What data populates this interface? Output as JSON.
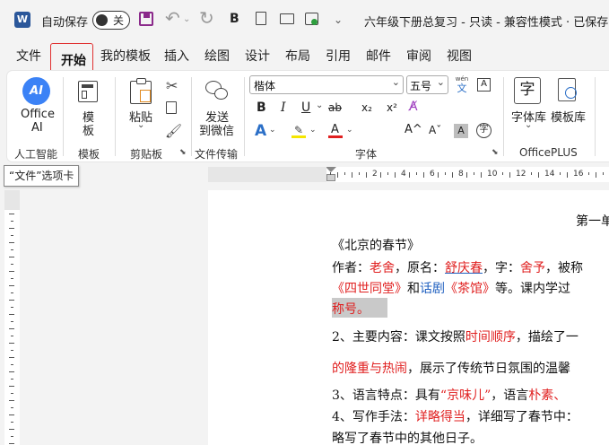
{
  "titlebar": {
    "app_icon": "word-icon",
    "autosave_label": "自动保存",
    "autosave_state": "关",
    "bold": "B",
    "doc_title": "六年级下册总复习 - 只读 - 兼容性模式 · 已保存"
  },
  "tabs": [
    "文件",
    "开始",
    "我的模板",
    "插入",
    "绘图",
    "设计",
    "布局",
    "引用",
    "邮件",
    "审阅",
    "视图"
  ],
  "ribbon": {
    "office_ai": "Office\nAI",
    "office_ai_l1": "Office",
    "office_ai_l2": "AI",
    "office_ai_badge": "AI",
    "template_l1": "模",
    "template_l2": "板",
    "paste": "粘贴",
    "send_l1": "发送",
    "send_l2": "到微信",
    "font_name": "楷体",
    "font_size": "五号",
    "wen": "wén",
    "wen_char": "文",
    "font_lib": "字体库",
    "template_lib": "模板库",
    "zi": "字",
    "group_ai": "人工智能",
    "group_template": "模板",
    "group_clipboard": "剪贴板",
    "group_transfer": "文件传输",
    "group_font": "字体",
    "group_officeplus": "OfficePLUS",
    "fmt": {
      "b": "B",
      "i": "I",
      "u": "U",
      "s": "ab",
      "sub": "x₂",
      "sup": "x²",
      "A1": "A",
      "A2": "A",
      "Ainc": "A^",
      "Adec": "Aˇ",
      "Aa": "Aa",
      "circ": "字"
    }
  },
  "tooltip": "“文件”选项卡",
  "ruler": [
    "2",
    "4",
    "6",
    "8",
    "10",
    "12",
    "14",
    "16"
  ],
  "document": {
    "heading": "第一单",
    "title": "《北京的春节》",
    "l1": {
      "a": "作者：",
      "b": "老舍",
      "c": "，原名：",
      "d": "舒庆春",
      "e": "，字：",
      "f": "舍予",
      "g": "，被称"
    },
    "l2": {
      "a": "《四世同堂》",
      "b": "和",
      "c": "话剧",
      "d": "《茶馆》",
      "e": "等。课内学过"
    },
    "l3": "称号。",
    "l4": {
      "a": "2、主要内容：课文按照",
      "b": "时间顺序",
      "c": "，描绘了一"
    },
    "l5": {
      "a": "的隆重与热闹",
      "b": "，展示了传统节日氛围的温馨"
    },
    "l6": {
      "a": "3、语言特点：具有",
      "b": "“京味儿”",
      "c": "，语言",
      "d": "朴素、"
    },
    "l7": {
      "a": "4、写作手法：",
      "b": "详略得当",
      "c": "，详细写了春节中："
    },
    "l8": "略写了春节中的其他日子。"
  },
  "colors": {
    "accent": "#2b579a",
    "red": "#e02020",
    "highlight": "#c9c9c9",
    "ai_blue": "#3b82f6"
  }
}
